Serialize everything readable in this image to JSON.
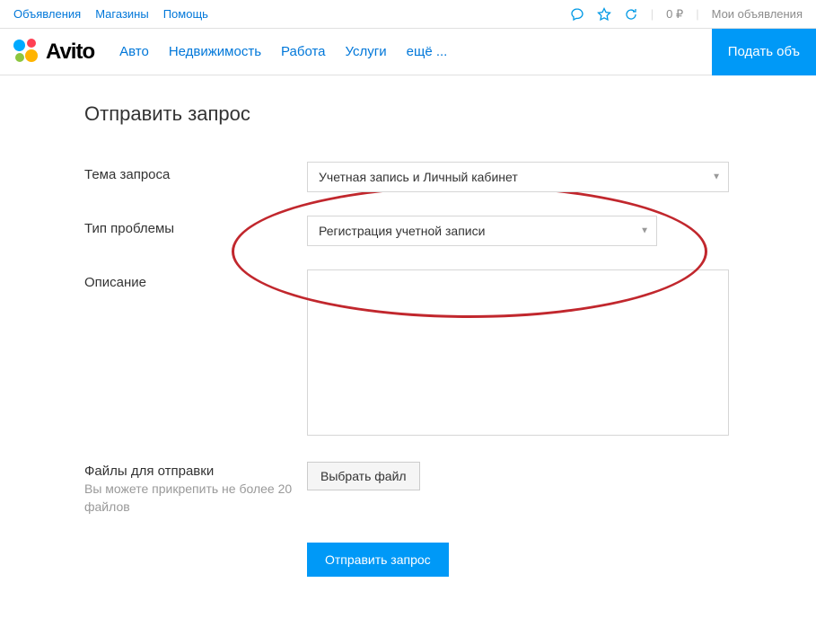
{
  "topbar": {
    "links": [
      "Объявления",
      "Магазины",
      "Помощь"
    ],
    "price": "0 ₽",
    "my_ads": "Мои объявления"
  },
  "header": {
    "logo_text": "Avito",
    "nav": [
      "Авто",
      "Недвижимость",
      "Работа",
      "Услуги",
      "ещё ..."
    ],
    "post_button": "Подать объ"
  },
  "form": {
    "title": "Отправить запрос",
    "topic_label": "Тема запроса",
    "topic_value": "Учетная запись и Личный кабинет",
    "problem_label": "Тип проблемы",
    "problem_value": "Регистрация учетной записи",
    "description_label": "Описание",
    "files_label": "Файлы для отправки",
    "files_hint": "Вы можете прикрепить не более 20 файлов",
    "file_button": "Выбрать файл",
    "submit": "Отправить запрос"
  }
}
